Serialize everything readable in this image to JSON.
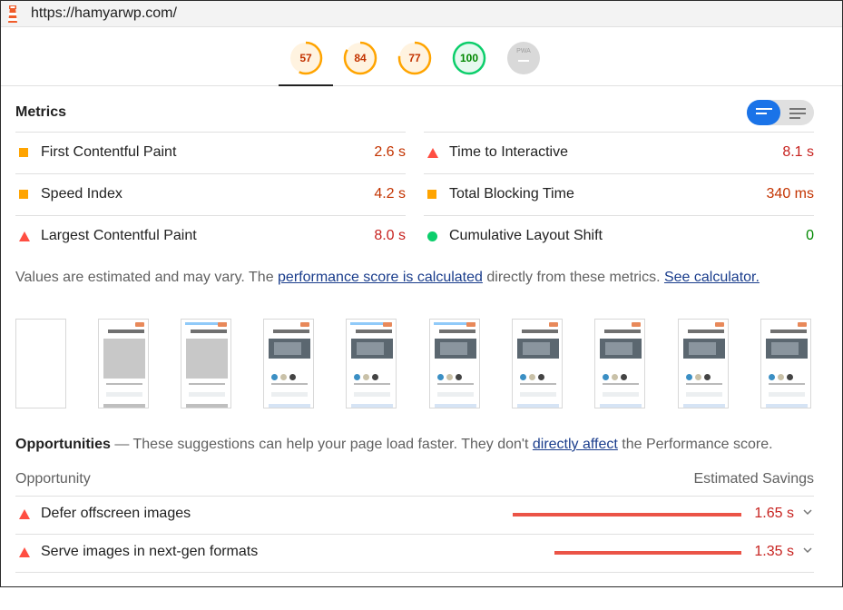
{
  "url": "https://hamyarwp.com/",
  "gauges": [
    {
      "name": "gauge-performance",
      "score": "57",
      "rating": "average",
      "color": "#ffa400"
    },
    {
      "name": "gauge-accessibility",
      "score": "84",
      "rating": "average",
      "color": "#ffa400"
    },
    {
      "name": "gauge-best-practices",
      "score": "77",
      "rating": "average",
      "color": "#ffa400"
    },
    {
      "name": "gauge-seo",
      "score": "100",
      "rating": "pass",
      "color": "#0cce6b"
    },
    {
      "name": "gauge-pwa",
      "score": "PWA",
      "rating": "na",
      "color": "#d6d6d6"
    }
  ],
  "metrics": {
    "title": "Metrics",
    "items": [
      {
        "label": "First Contentful Paint",
        "value": "2.6 s",
        "icon": "square-average-icon",
        "status": "average"
      },
      {
        "label": "Time to Interactive",
        "value": "8.1 s",
        "icon": "triangle-fail-icon",
        "status": "fail"
      },
      {
        "label": "Speed Index",
        "value": "4.2 s",
        "icon": "square-average-icon",
        "status": "average"
      },
      {
        "label": "Total Blocking Time",
        "value": "340 ms",
        "icon": "square-average-icon",
        "status": "average"
      },
      {
        "label": "Largest Contentful Paint",
        "value": "8.0 s",
        "icon": "triangle-fail-icon",
        "status": "fail"
      },
      {
        "label": "Cumulative Layout Shift",
        "value": "0",
        "icon": "circle-pass-icon",
        "status": "pass"
      }
    ],
    "note_prefix": "Values are estimated and may vary. The ",
    "note_link1": "performance score is calculated",
    "note_middle": " directly from these metrics. ",
    "note_link2": "See calculator."
  },
  "opportunities": {
    "title": "Opportunities",
    "desc_prefix": " — These suggestions can help your page load faster. They don't ",
    "desc_link": "directly affect",
    "desc_suffix": " the Performance score.",
    "col_left": "Opportunity",
    "col_right": "Estimated Savings",
    "items": [
      {
        "label": "Defer offscreen images",
        "saving": "1.65 s",
        "fraction": 1.0
      },
      {
        "label": "Serve images in next-gen formats",
        "saving": "1.35 s",
        "fraction": 0.8182
      }
    ]
  },
  "colors": {
    "fail": "#ff4e42",
    "average": "#ffa400",
    "pass": "#0cce6b",
    "link": "#1a3d8c",
    "accent": "#1a73e8"
  }
}
